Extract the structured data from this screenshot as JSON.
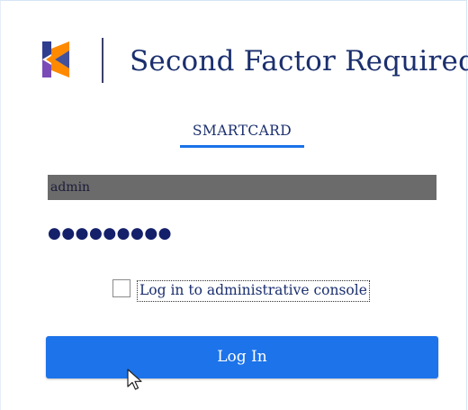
{
  "header": {
    "title": "Second Factor Required",
    "logo_icon": "stacked-chevron-logo-icon",
    "logo_colors": [
      "#ff8a00",
      "#2f3d8f",
      "#7b4bb8"
    ]
  },
  "tabs": [
    {
      "label": "SMARTCARD",
      "active": true
    }
  ],
  "form": {
    "username_value": "admin",
    "password_masked": "●●●●●●●●●",
    "admin_console_label": "Log in to administrative console",
    "admin_console_checked": false,
    "submit_label": "Log In"
  },
  "colors": {
    "accent": "#1a73e8",
    "title_text": "#1b2f6e"
  },
  "cursor_icon": "mouse-pointer-icon"
}
